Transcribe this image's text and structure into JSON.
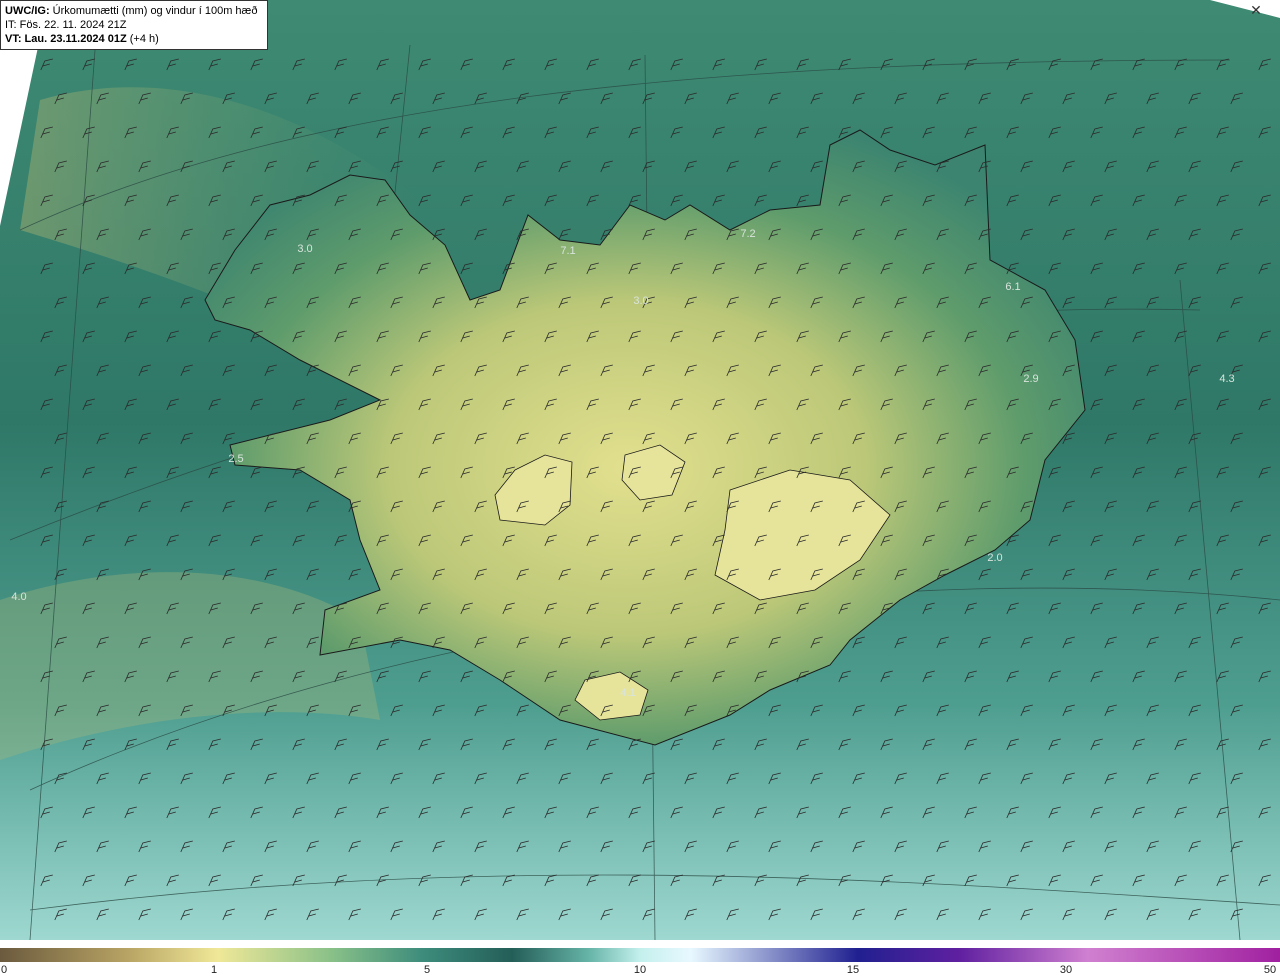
{
  "header": {
    "model_prefix": "UWC/IG:",
    "title": "Úrkomumætti (mm) og vindur í 100m hæð",
    "it_line": "IT: Fös. 22. 11. 2024 21Z",
    "vt_prefix": "VT: Lau. 23.11.2024 01Z",
    "vt_suffix": "(+4 h)"
  },
  "close_icon": "close-icon",
  "value_labels": [
    "3.0",
    "7.1",
    "7.2",
    "3.0",
    "6.1",
    "2.9",
    "4.3",
    "2.5",
    "2.0",
    "4.0",
    "4.1"
  ],
  "colorbar": {
    "ticks": [
      "0",
      "1",
      "5",
      "10",
      "15",
      "30",
      "50"
    ],
    "colors": [
      "#6b5a3e",
      "#b8a464",
      "#f0e898",
      "#88c088",
      "#3d8c7c",
      "#245e58",
      "#66b4a8",
      "#c4f0ec",
      "#e8f8ff",
      "#202090",
      "#6020a0",
      "#d080d0",
      "#a020a0"
    ]
  }
}
